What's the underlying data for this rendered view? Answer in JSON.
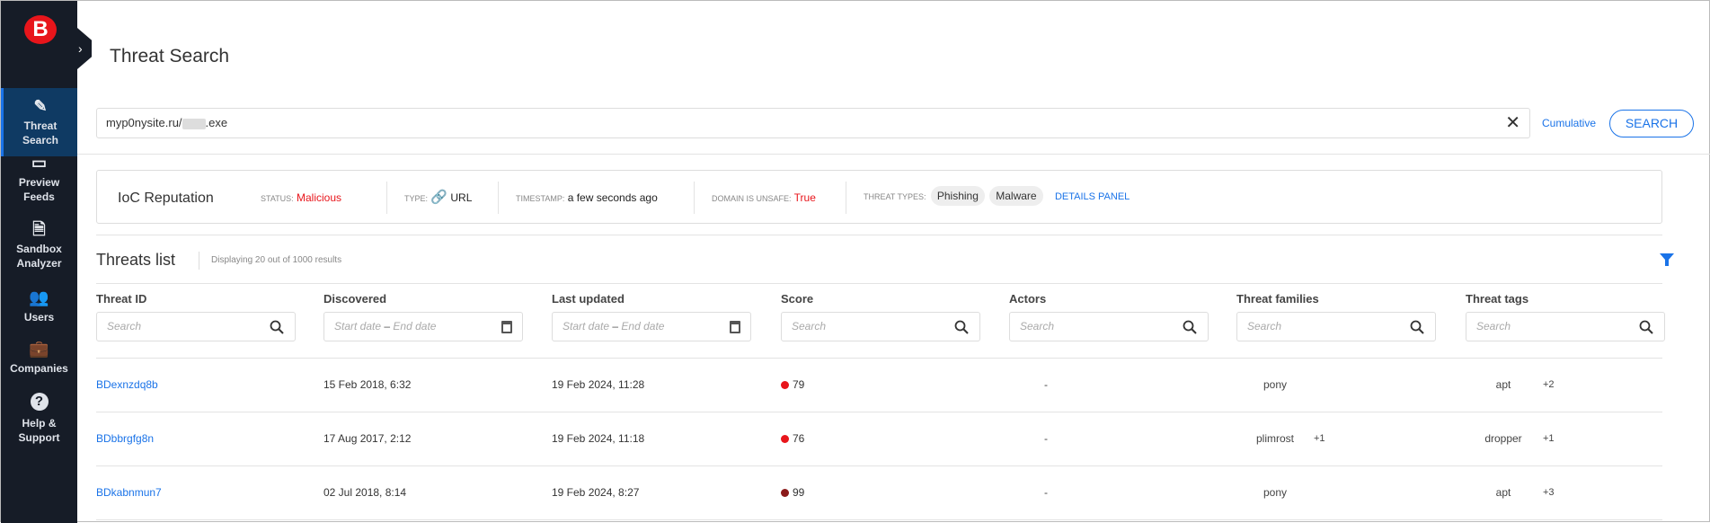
{
  "sidebar": {
    "logo": "B",
    "items": [
      {
        "label": "Threat Search",
        "icon": "document-edit-icon",
        "active": true
      },
      {
        "label": "Preview Feeds",
        "icon": "folder-icon"
      },
      {
        "label": "Sandbox Analyzer",
        "icon": "file-search-icon"
      },
      {
        "label": "Users",
        "icon": "users-icon"
      },
      {
        "label": "Companies",
        "icon": "briefcase-icon"
      },
      {
        "label": "Help & Support",
        "icon": "help-icon"
      }
    ]
  },
  "header": {
    "title": "Threat Search"
  },
  "search": {
    "value_prefix": "myp0nysite.ru/",
    "value_suffix": ".exe",
    "cumulative": "Cumulative",
    "button": "SEARCH"
  },
  "ioc": {
    "title": "IoC Reputation",
    "status_label": "STATUS:",
    "status": "Malicious",
    "type_label": "TYPE:",
    "type": "URL",
    "timestamp_label": "TIMESTAMP:",
    "timestamp": "a few seconds ago",
    "domain_label": "DOMAIN IS UNSAFE:",
    "domain": "True",
    "types_label": "THREAT TYPES:",
    "types": [
      "Phishing",
      "Malware"
    ],
    "details": "DETAILS PANEL"
  },
  "threats": {
    "title": "Threats list",
    "count": "Displaying 20 out of 1000 results",
    "columns": [
      "Threat ID",
      "Discovered",
      "Last updated",
      "Score",
      "Actors",
      "Threat families",
      "Threat tags"
    ],
    "search_placeholder": "Search",
    "start_date": "Start date",
    "dash": "–",
    "end_date": "End date",
    "rows": [
      {
        "id": "BDexnzdq8b",
        "discovered": "15 Feb 2018, 6:32",
        "updated": "19 Feb 2024, 11:28",
        "score": "79",
        "score_color": "#e8151b",
        "actors": "-",
        "family": "pony",
        "family_more": "",
        "tag": "apt",
        "tag_more": "+2"
      },
      {
        "id": "BDbbrgfg8n",
        "discovered": "17 Aug 2017, 2:12",
        "updated": "19 Feb 2024, 11:18",
        "score": "76",
        "score_color": "#e8151b",
        "actors": "-",
        "family": "plimrost",
        "family_more": "+1",
        "tag": "dropper",
        "tag_more": "+1"
      },
      {
        "id": "BDkabnmun7",
        "discovered": "02 Jul 2018, 8:14",
        "updated": "19 Feb 2024, 8:27",
        "score": "99",
        "score_color": "#8b1a1a",
        "actors": "-",
        "family": "pony",
        "family_more": "",
        "tag": "apt",
        "tag_more": "+3"
      }
    ]
  },
  "colors": {
    "accent": "#1a73e8",
    "sidebar": "#161c27",
    "danger": "#e8151b"
  }
}
